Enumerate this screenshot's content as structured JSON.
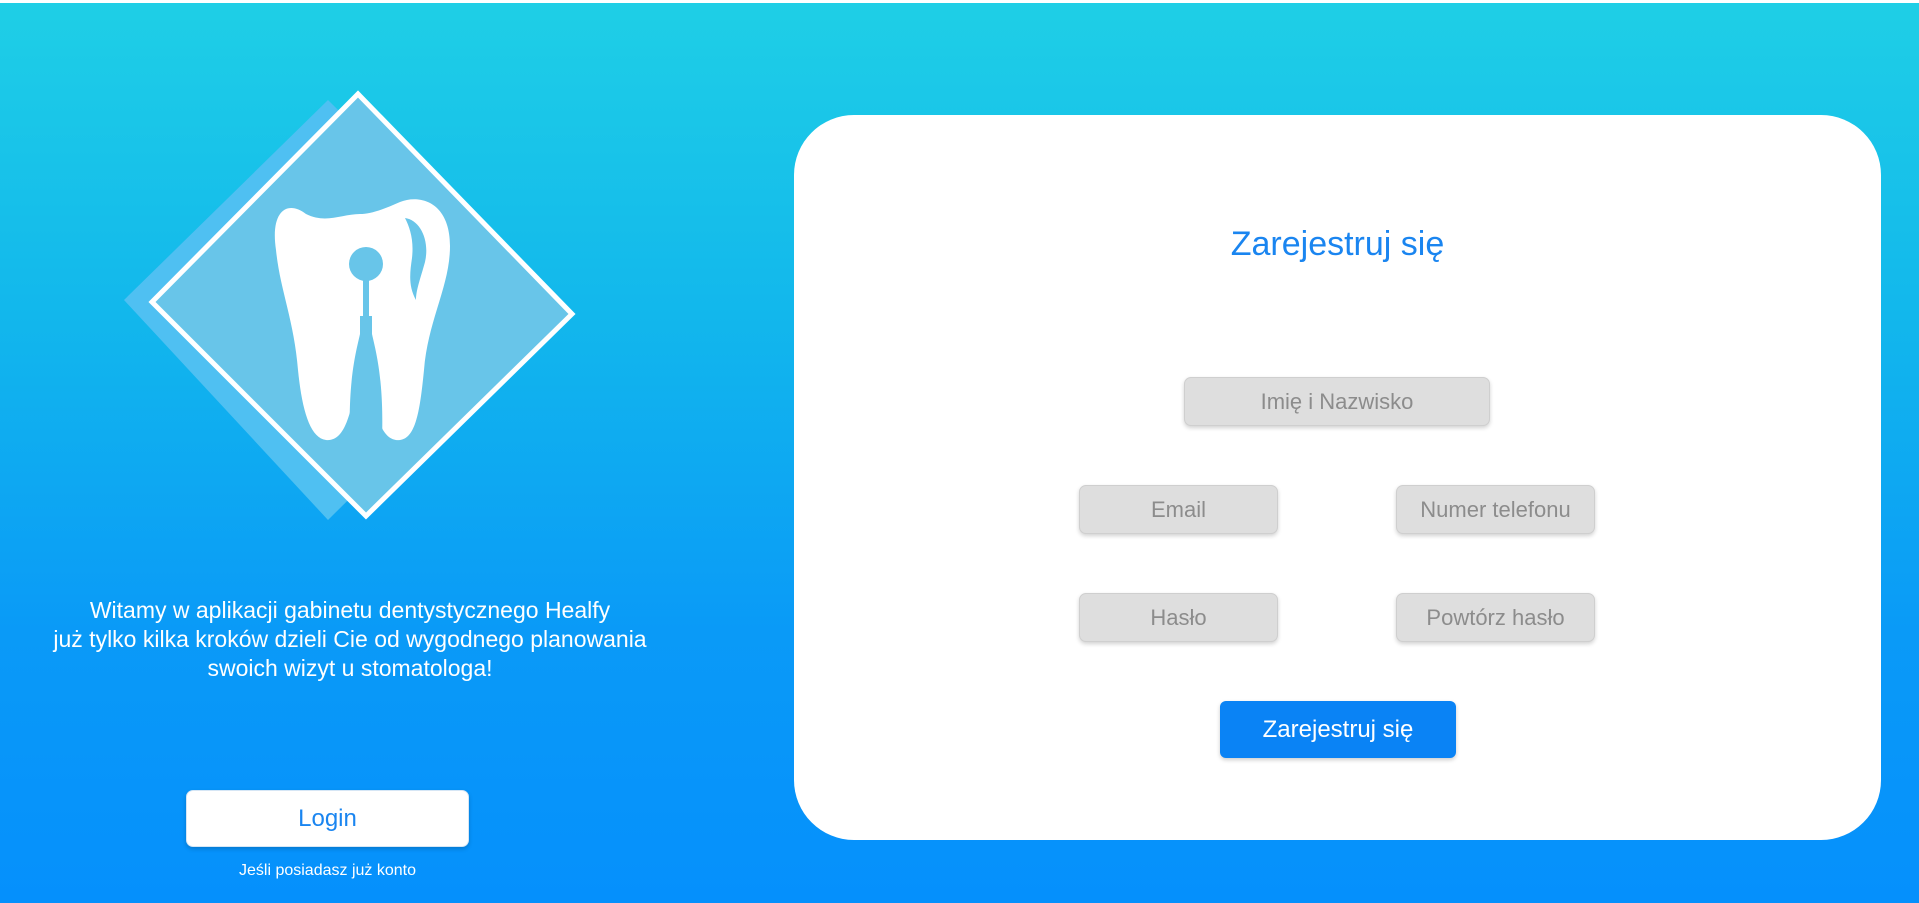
{
  "left": {
    "logo_icon": "tooth-root-canal-icon",
    "welcome_lines": [
      "Witamy w aplikacji gabinetu dentystycznego Healfy",
      "już tylko kilka kroków dzieli Cie od wygodnego planowania",
      "swoich wizyt u stomatologa!"
    ],
    "login_label": "Login",
    "login_hint": "Jeśli posiadasz już konto"
  },
  "register": {
    "title": "Zarejestruj się",
    "fields": {
      "name": {
        "placeholder": "Imię i Nazwisko",
        "value": ""
      },
      "email": {
        "placeholder": "Email",
        "value": ""
      },
      "phone": {
        "placeholder": "Numer telefonu",
        "value": ""
      },
      "password": {
        "placeholder": "Hasło",
        "value": ""
      },
      "password_repeat": {
        "placeholder": "Powtórz hasło",
        "value": ""
      }
    },
    "submit_label": "Zarejestruj się"
  },
  "colors": {
    "accent": "#1a85f0",
    "button": "#0a83f5",
    "field_bg": "#dedede",
    "logo_fill": "#68c5e9"
  }
}
